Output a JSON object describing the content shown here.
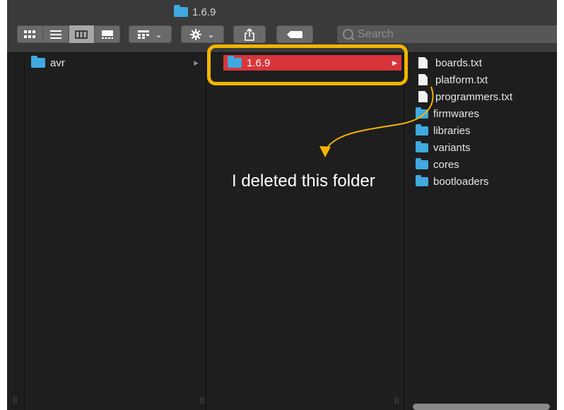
{
  "window": {
    "title": "1.6.9"
  },
  "toolbar": {
    "view_modes": [
      "icon-view",
      "list-view",
      "column-view",
      "gallery-view"
    ],
    "active_view": "column-view",
    "group_icon": "group-icon",
    "action_icon": "gear-icon",
    "share_icon": "share-icon",
    "tag_icon": "tag-icon",
    "dropdown_glyph": "⌄"
  },
  "search": {
    "placeholder": "Search"
  },
  "columns": {
    "col2": {
      "items": [
        {
          "label": "avr",
          "type": "folder"
        }
      ]
    },
    "col3": {
      "items": [
        {
          "label": "1.6.9",
          "type": "folder",
          "selected": true
        }
      ]
    },
    "col4": {
      "items": [
        {
          "label": "boards.txt",
          "type": "file"
        },
        {
          "label": "platform.txt",
          "type": "file"
        },
        {
          "label": "programmers.txt",
          "type": "file"
        },
        {
          "label": "firmwares",
          "type": "folder"
        },
        {
          "label": "libraries",
          "type": "folder"
        },
        {
          "label": "variants",
          "type": "folder"
        },
        {
          "label": "cores",
          "type": "folder"
        },
        {
          "label": "bootloaders",
          "type": "folder"
        }
      ]
    }
  },
  "annotation": {
    "text": "I deleted this folder",
    "color": "#f4b400"
  },
  "colors": {
    "selection": "#d8353a",
    "folder": "#3fa9e0",
    "highlight": "#f4b400"
  }
}
